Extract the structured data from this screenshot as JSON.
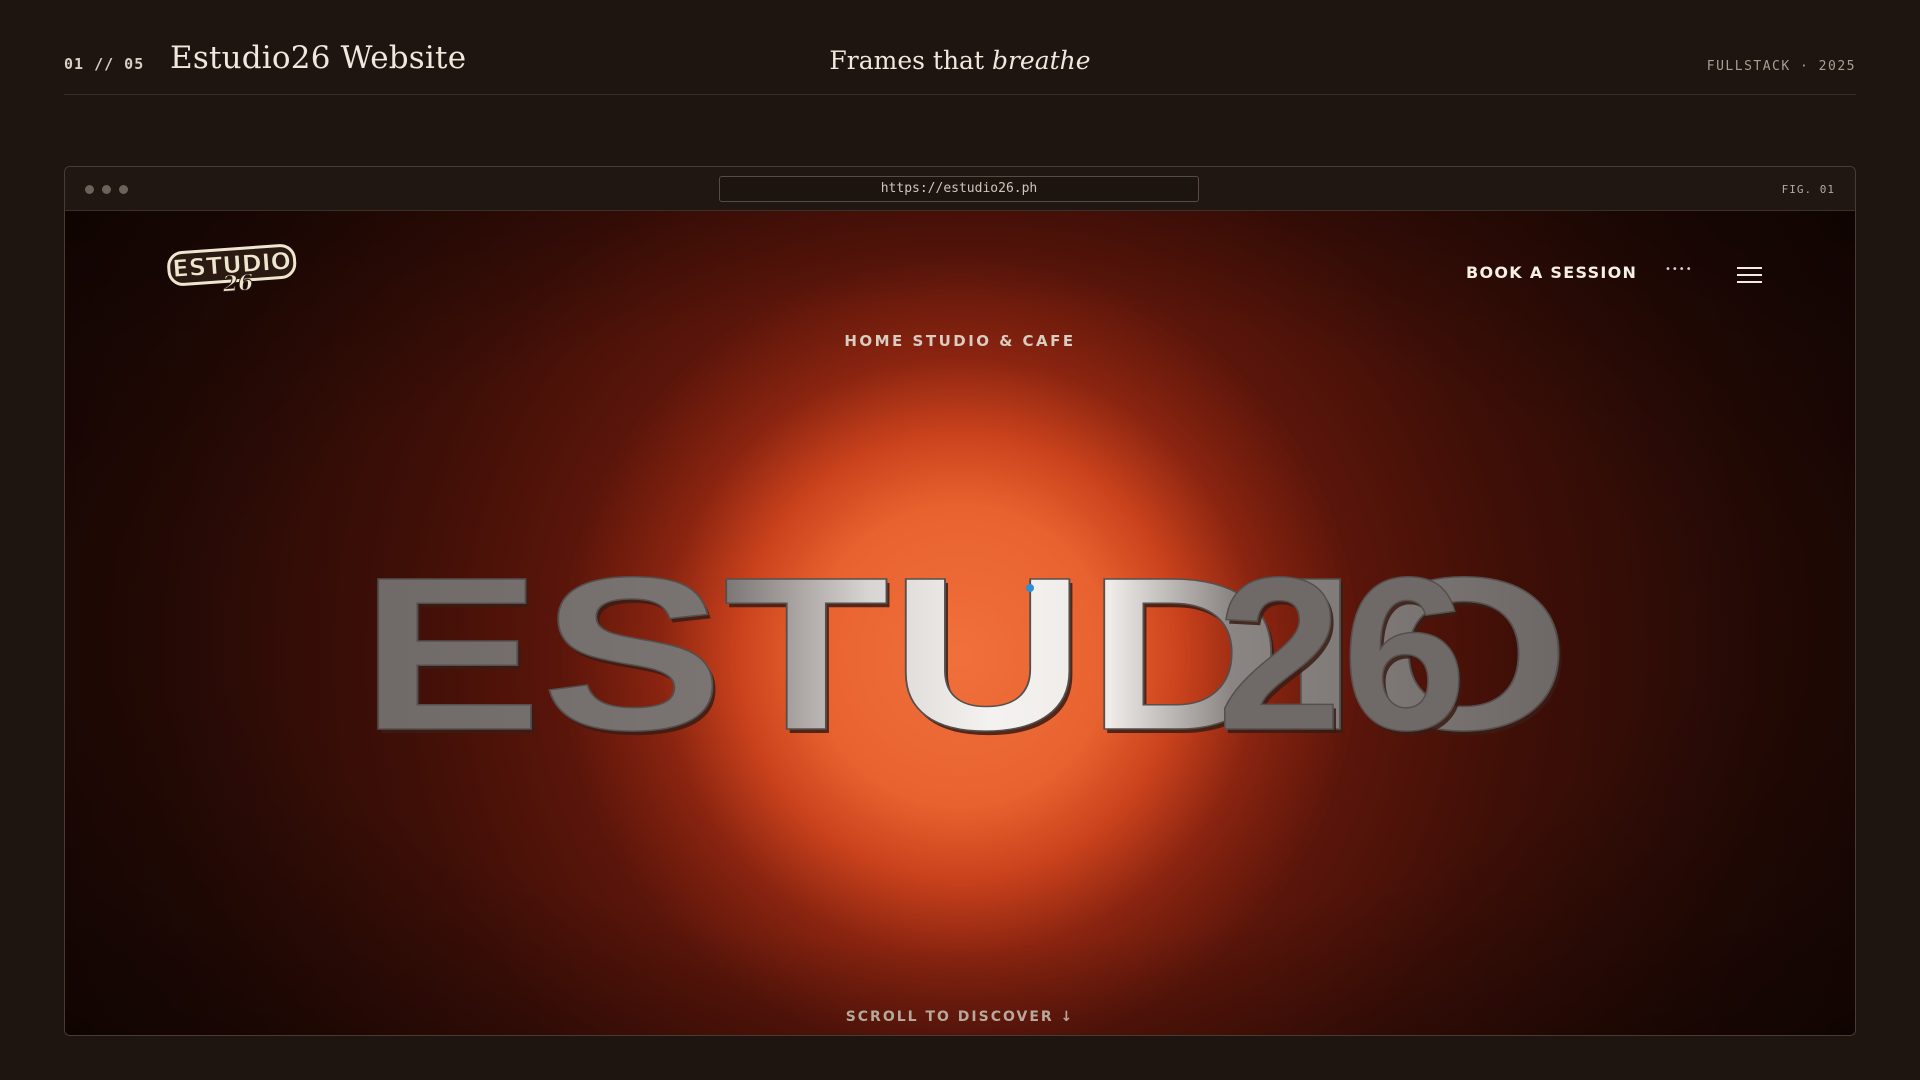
{
  "header": {
    "counter": "01 // 05",
    "project_title": "Estudio26 Website",
    "tagline_plain": "Frames that",
    "tagline_italic": "breathe",
    "meta": "FULLSTACK · 2025"
  },
  "browser": {
    "url": "https://estudio26.ph",
    "figure_label": "FIG. 01"
  },
  "site": {
    "logo_text_top": "ESTUDIO",
    "logo_text_script": "26",
    "nav_cta": "BOOK A SESSION",
    "nav_dots": "••••",
    "eyebrow": "HOME STUDIO & CAFE",
    "hero_word": "ESTUDIO",
    "hero_number": "26",
    "scroll_hint": "SCROLL TO DISCOVER ↓"
  },
  "colors": {
    "page_bg": "#1f1510",
    "glow": "#f0703c",
    "hero_dark_text": "#6f6a68",
    "hero_light_text": "#f2f0ee",
    "cursor_dot": "#2d8fd5",
    "logo_fill": "#efe6cf"
  }
}
